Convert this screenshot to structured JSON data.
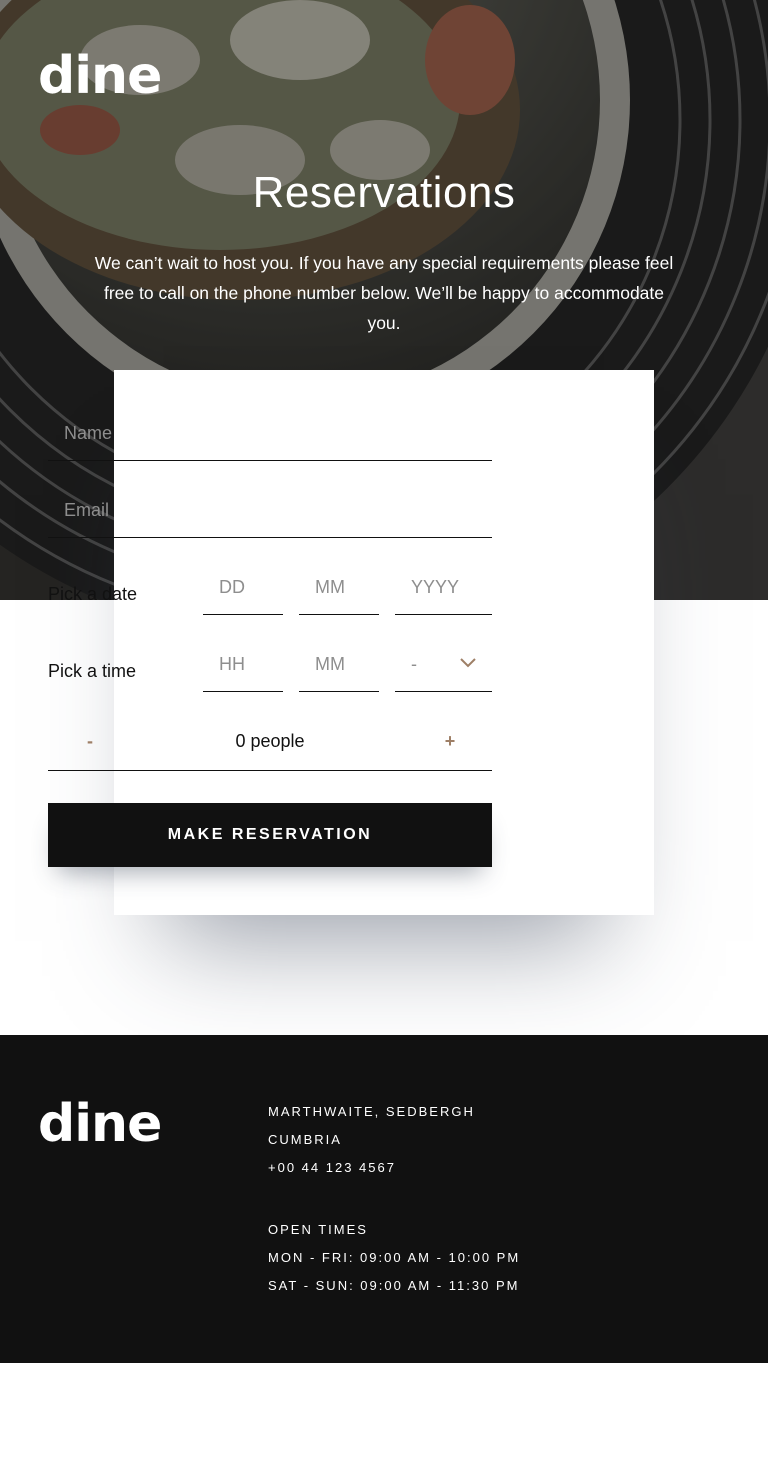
{
  "brand": {
    "logo": "dine"
  },
  "hero": {
    "title": "Reservations",
    "text": "We can’t wait to host you. If you have any special requirements please feel free to call on the phone number below. We’ll be happy to accommodate you."
  },
  "form": {
    "name_placeholder": "Name",
    "email_placeholder": "Email",
    "date_label": "Pick a date",
    "date_placeholders": {
      "day": "DD",
      "month": "MM",
      "year": "YYYY"
    },
    "time_label": "Pick a time",
    "time_placeholders": {
      "hour": "HH",
      "minute": "MM"
    },
    "ampm_value": "-",
    "ampm_icon": "chevron-down-icon",
    "people": {
      "minus": "-",
      "count_text": "0 people",
      "plus": "+"
    },
    "submit_label": "MAKE RESERVATION"
  },
  "footer": {
    "logo": "dine",
    "address": [
      "MARTHWAITE, SEDBERGH",
      "CUMBRIA",
      "+00 44 123 4567"
    ],
    "hours": [
      "OPEN TIMES",
      "MON - FRI: 09:00 AM - 10:00 PM",
      "SAT - SUN: 09:00 AM - 11:30 PM"
    ]
  },
  "colors": {
    "dark": "#111111",
    "accent": "#9e7f66",
    "placeholder": "#8e8e8e",
    "white": "#ffffff"
  }
}
